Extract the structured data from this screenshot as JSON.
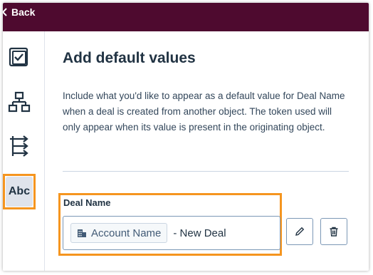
{
  "header": {
    "back_label": "Back"
  },
  "sidebar": {
    "items": [
      {
        "name": "checklist-icon"
      },
      {
        "name": "hierarchy-icon"
      },
      {
        "name": "branch-arrows-icon"
      },
      {
        "name": "text-abc-icon",
        "label": "Abc",
        "active": true
      }
    ]
  },
  "main": {
    "title": "Add default values",
    "description": "Include what you'd like to appear as a default value for Deal Name when a deal is created from another object. The token used will only appear when its value is present in the originating object.",
    "field": {
      "label": "Deal Name",
      "token_label": "Account Name",
      "suffix": "- New Deal"
    }
  },
  "colors": {
    "header_bg": "#4e0a2f",
    "highlight": "#f5951f",
    "text_primary": "#213343"
  }
}
